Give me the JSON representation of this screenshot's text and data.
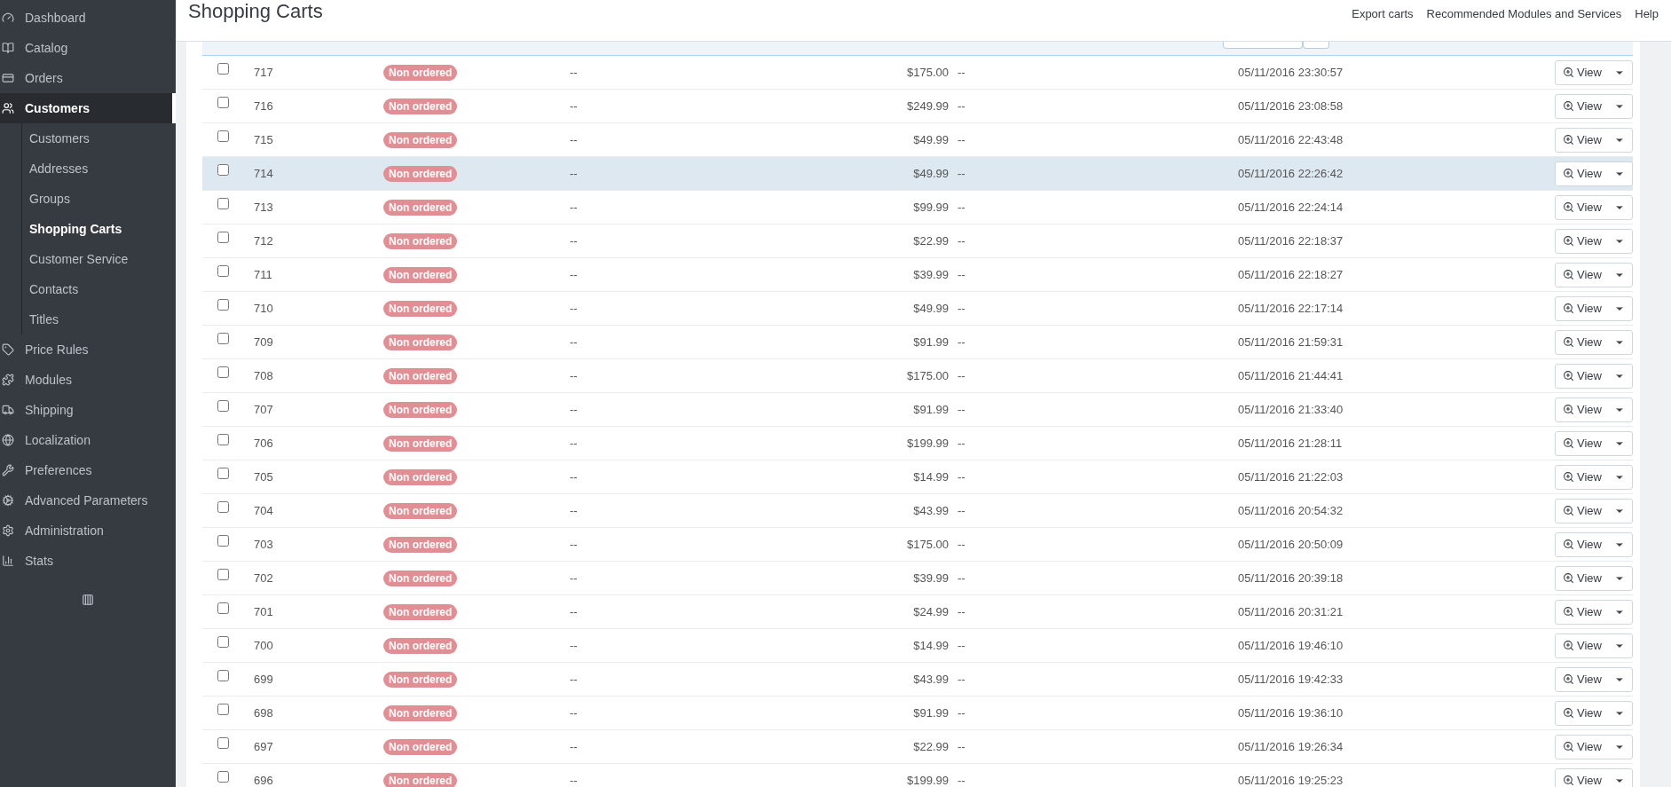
{
  "sidebar": {
    "items": [
      {
        "label": "Dashboard",
        "selected": false
      },
      {
        "label": "Catalog",
        "selected": false
      },
      {
        "label": "Orders",
        "selected": false
      },
      {
        "label": "Customers",
        "selected": true,
        "children": [
          {
            "label": "Customers",
            "selected": false
          },
          {
            "label": "Addresses",
            "selected": false
          },
          {
            "label": "Groups",
            "selected": false
          },
          {
            "label": "Shopping Carts",
            "selected": true
          },
          {
            "label": "Customer Service",
            "selected": false
          },
          {
            "label": "Contacts",
            "selected": false
          },
          {
            "label": "Titles",
            "selected": false
          }
        ]
      },
      {
        "label": "Price Rules",
        "selected": false
      },
      {
        "label": "Modules",
        "selected": false
      },
      {
        "label": "Shipping",
        "selected": false
      },
      {
        "label": "Localization",
        "selected": false
      },
      {
        "label": "Preferences",
        "selected": false
      },
      {
        "label": "Advanced Parameters",
        "selected": false
      },
      {
        "label": "Administration",
        "selected": false
      },
      {
        "label": "Stats",
        "selected": false
      }
    ]
  },
  "page": {
    "title": "Shopping Carts",
    "toolbar": [
      "Export carts",
      "Recommended Modules and Services",
      "Help"
    ]
  },
  "table": {
    "rows": [
      {
        "id": "717",
        "status": "Non ordered",
        "customer": "--",
        "total": "$175.00",
        "carrier": "--",
        "date": "05/11/2016 23:30:57",
        "action": "View",
        "checked": false,
        "highlighted": false
      },
      {
        "id": "716",
        "status": "Non ordered",
        "customer": "--",
        "total": "$249.99",
        "carrier": "--",
        "date": "05/11/2016 23:08:58",
        "action": "View",
        "checked": false,
        "highlighted": false
      },
      {
        "id": "715",
        "status": "Non ordered",
        "customer": "--",
        "total": "$49.99",
        "carrier": "--",
        "date": "05/11/2016 22:43:48",
        "action": "View",
        "checked": false,
        "highlighted": false
      },
      {
        "id": "714",
        "status": "Non ordered",
        "customer": "--",
        "total": "$49.99",
        "carrier": "--",
        "date": "05/11/2016 22:26:42",
        "action": "View",
        "checked": false,
        "highlighted": true
      },
      {
        "id": "713",
        "status": "Non ordered",
        "customer": "--",
        "total": "$99.99",
        "carrier": "--",
        "date": "05/11/2016 22:24:14",
        "action": "View",
        "checked": false,
        "highlighted": false
      },
      {
        "id": "712",
        "status": "Non ordered",
        "customer": "--",
        "total": "$22.99",
        "carrier": "--",
        "date": "05/11/2016 22:18:37",
        "action": "View",
        "checked": false,
        "highlighted": false
      },
      {
        "id": "711",
        "status": "Non ordered",
        "customer": "--",
        "total": "$39.99",
        "carrier": "--",
        "date": "05/11/2016 22:18:27",
        "action": "View",
        "checked": false,
        "highlighted": false
      },
      {
        "id": "710",
        "status": "Non ordered",
        "customer": "--",
        "total": "$49.99",
        "carrier": "--",
        "date": "05/11/2016 22:17:14",
        "action": "View",
        "checked": false,
        "highlighted": false
      },
      {
        "id": "709",
        "status": "Non ordered",
        "customer": "--",
        "total": "$91.99",
        "carrier": "--",
        "date": "05/11/2016 21:59:31",
        "action": "View",
        "checked": false,
        "highlighted": false
      },
      {
        "id": "708",
        "status": "Non ordered",
        "customer": "--",
        "total": "$175.00",
        "carrier": "--",
        "date": "05/11/2016 21:44:41",
        "action": "View",
        "checked": false,
        "highlighted": false
      },
      {
        "id": "707",
        "status": "Non ordered",
        "customer": "--",
        "total": "$91.99",
        "carrier": "--",
        "date": "05/11/2016 21:33:40",
        "action": "View",
        "checked": false,
        "highlighted": false
      },
      {
        "id": "706",
        "status": "Non ordered",
        "customer": "--",
        "total": "$199.99",
        "carrier": "--",
        "date": "05/11/2016 21:28:11",
        "action": "View",
        "checked": false,
        "highlighted": false
      },
      {
        "id": "705",
        "status": "Non ordered",
        "customer": "--",
        "total": "$14.99",
        "carrier": "--",
        "date": "05/11/2016 21:22:03",
        "action": "View",
        "checked": false,
        "highlighted": false
      },
      {
        "id": "704",
        "status": "Non ordered",
        "customer": "--",
        "total": "$43.99",
        "carrier": "--",
        "date": "05/11/2016 20:54:32",
        "action": "View",
        "checked": false,
        "highlighted": false
      },
      {
        "id": "703",
        "status": "Non ordered",
        "customer": "--",
        "total": "$175.00",
        "carrier": "--",
        "date": "05/11/2016 20:50:09",
        "action": "View",
        "checked": false,
        "highlighted": false
      },
      {
        "id": "702",
        "status": "Non ordered",
        "customer": "--",
        "total": "$39.99",
        "carrier": "--",
        "date": "05/11/2016 20:39:18",
        "action": "View",
        "checked": false,
        "highlighted": false
      },
      {
        "id": "701",
        "status": "Non ordered",
        "customer": "--",
        "total": "$24.99",
        "carrier": "--",
        "date": "05/11/2016 20:31:21",
        "action": "View",
        "checked": false,
        "highlighted": false
      },
      {
        "id": "700",
        "status": "Non ordered",
        "customer": "--",
        "total": "$14.99",
        "carrier": "--",
        "date": "05/11/2016 19:46:10",
        "action": "View",
        "checked": false,
        "highlighted": false
      },
      {
        "id": "699",
        "status": "Non ordered",
        "customer": "--",
        "total": "$43.99",
        "carrier": "--",
        "date": "05/11/2016 19:42:33",
        "action": "View",
        "checked": false,
        "highlighted": false
      },
      {
        "id": "698",
        "status": "Non ordered",
        "customer": "--",
        "total": "$91.99",
        "carrier": "--",
        "date": "05/11/2016 19:36:10",
        "action": "View",
        "checked": false,
        "highlighted": false
      },
      {
        "id": "697",
        "status": "Non ordered",
        "customer": "--",
        "total": "$22.99",
        "carrier": "--",
        "date": "05/11/2016 19:26:34",
        "action": "View",
        "checked": false,
        "highlighted": false
      },
      {
        "id": "696",
        "status": "Non ordered",
        "customer": "--",
        "total": "$199.99",
        "carrier": "--",
        "date": "05/11/2016 19:25:23",
        "action": "View",
        "checked": false,
        "highlighted": false
      }
    ]
  }
}
